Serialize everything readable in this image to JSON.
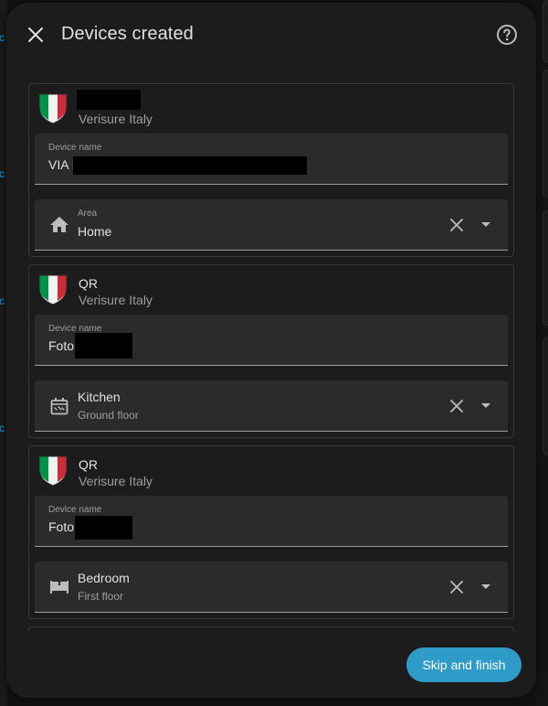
{
  "dialog": {
    "title": "Devices created",
    "close_icon": "close-icon",
    "help_icon": "help-circle-icon"
  },
  "devices": [
    {
      "model": "",
      "model_redacted": true,
      "manufacturer": "Verisure Italy",
      "name_label": "Device name",
      "name_value": "VIA I",
      "area_label": "Area",
      "area_name": "Home",
      "area_floor": "",
      "area_icon": "home-icon"
    },
    {
      "model": "QR",
      "model_redacted": false,
      "manufacturer": "Verisure Italy",
      "name_label": "Device name",
      "name_value": "Foto",
      "area_label": "",
      "area_name": "Kitchen",
      "area_floor": "Ground floor",
      "area_icon": "stove-icon"
    },
    {
      "model": "QR",
      "model_redacted": false,
      "manufacturer": "Verisure Italy",
      "name_label": "Device name",
      "name_value": "Foto",
      "area_label": "",
      "area_name": "Bedroom",
      "area_floor": "First floor",
      "area_icon": "bed-icon"
    }
  ],
  "footer": {
    "skip_label": "Skip and finish"
  },
  "colors": {
    "accent": "#2f9bc9",
    "dialog_bg": "#1c1c1c",
    "field_bg": "#2b2b2b",
    "secondary_text": "#9e9e9e",
    "flag_green": "#009246",
    "flag_white": "#f1f2f1",
    "flag_red": "#ce2b37"
  },
  "background": {
    "left_edge_chars": [
      "c",
      "c",
      "c",
      "c"
    ]
  }
}
